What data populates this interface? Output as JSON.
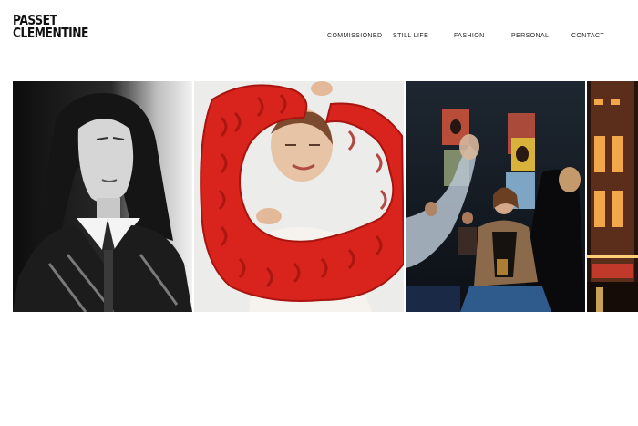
{
  "brand": {
    "line1": "PASSET",
    "line2": "CLEMENTINE"
  },
  "nav": {
    "items": [
      {
        "label": "COMMISSIONED"
      },
      {
        "label": "STILL LIFE"
      },
      {
        "label": "FASHION"
      },
      {
        "label": "PERSONAL"
      },
      {
        "label": "CONTACT"
      }
    ]
  },
  "colors": {
    "background": "#ffffff",
    "text": "#111111",
    "knit_red": "#d8241c"
  },
  "gallery": {
    "images": [
      {
        "icon": "portrait-bw-photo"
      },
      {
        "icon": "red-knit-sweater-photo"
      },
      {
        "icon": "night-bar-crowd-photo"
      },
      {
        "icon": "lit-building-night-photo"
      }
    ]
  }
}
